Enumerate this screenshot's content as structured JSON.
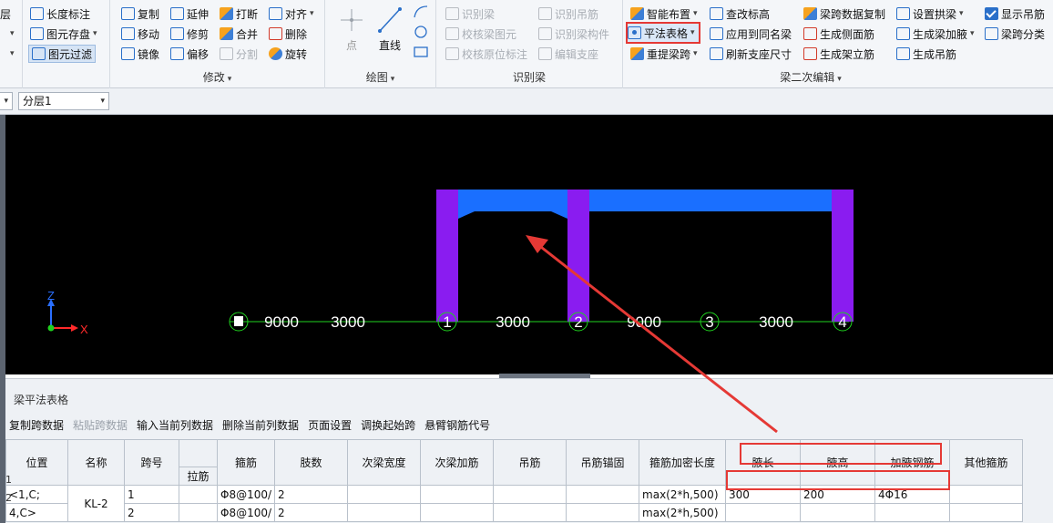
{
  "ribbon": {
    "col0": {
      "items": [
        "层",
        "",
        ""
      ]
    },
    "col1": {
      "items": [
        "长度标注",
        "图元存盘",
        "图元过滤"
      ]
    },
    "modify": {
      "title": "修改",
      "items": [
        "复制",
        "延伸",
        "打断",
        "对齐",
        "移动",
        "修剪",
        "合并",
        "删除",
        "镜像",
        "偏移",
        "分割",
        "旋转"
      ]
    },
    "draw": {
      "title": "绘图",
      "point": "点",
      "line": "直线"
    },
    "identify": {
      "title": "识别梁",
      "items": [
        "识别梁",
        "识别吊筋",
        "校核梁图元",
        "识别梁构件",
        "校核原位标注",
        "编辑支座"
      ]
    },
    "beam_edit": {
      "title": "梁二次编辑",
      "items": [
        "智能布置",
        "查改标高",
        "梁跨数据复制",
        "设置拱梁",
        "显示吊筋",
        "平法表格",
        "应用到同名梁",
        "生成侧面筋",
        "生成梁加腋",
        "梁跨分类",
        "重提梁跨",
        "刷新支座尺寸",
        "生成架立筋",
        "生成吊筋"
      ]
    }
  },
  "layerbar": {
    "left_value": "",
    "layer_value": "分层1"
  },
  "canvas": {
    "axis_labels": [
      "9000",
      "3000",
      "1",
      "3000",
      "2",
      "9000",
      "3",
      "3000",
      "4"
    ],
    "z_label": "Z",
    "x_label": "X"
  },
  "panel": {
    "title": "梁平法表格",
    "toolbar": [
      "复制跨数据",
      "粘贴跨数据",
      "输入当前列数据",
      "删除当前列数据",
      "页面设置",
      "调换起始跨",
      "悬臂钢筋代号"
    ],
    "headers": [
      "位置",
      "名称",
      "跨号",
      "",
      "箍筋",
      "肢数",
      "次梁宽度",
      "次梁加筋",
      "吊筋",
      "吊筋锚固",
      "箍筋加密长度",
      "腋长",
      "腋高",
      "加腋钢筋",
      "其他箍筋"
    ],
    "subheader": "拉筋",
    "rows": [
      {
        "num": "1",
        "pos": "<1,C;",
        "name": "KL-2",
        "span": "1",
        "stirrup": "Φ8@100/",
        "legs": "2",
        "dense": "max(2*h,500)",
        "hl": "300",
        "hh": "200",
        "hr": "4Φ16"
      },
      {
        "num": "2",
        "pos": "4,C>",
        "name": "",
        "span": "2",
        "stirrup": "Φ8@100/",
        "legs": "2",
        "dense": "max(2*h,500)",
        "hl": "",
        "hh": "",
        "hr": ""
      }
    ]
  },
  "colors": {
    "column": "#8a1cf0",
    "beam": "#1a6fff",
    "axis": "#1fd21f",
    "annotation": "#e53935"
  }
}
